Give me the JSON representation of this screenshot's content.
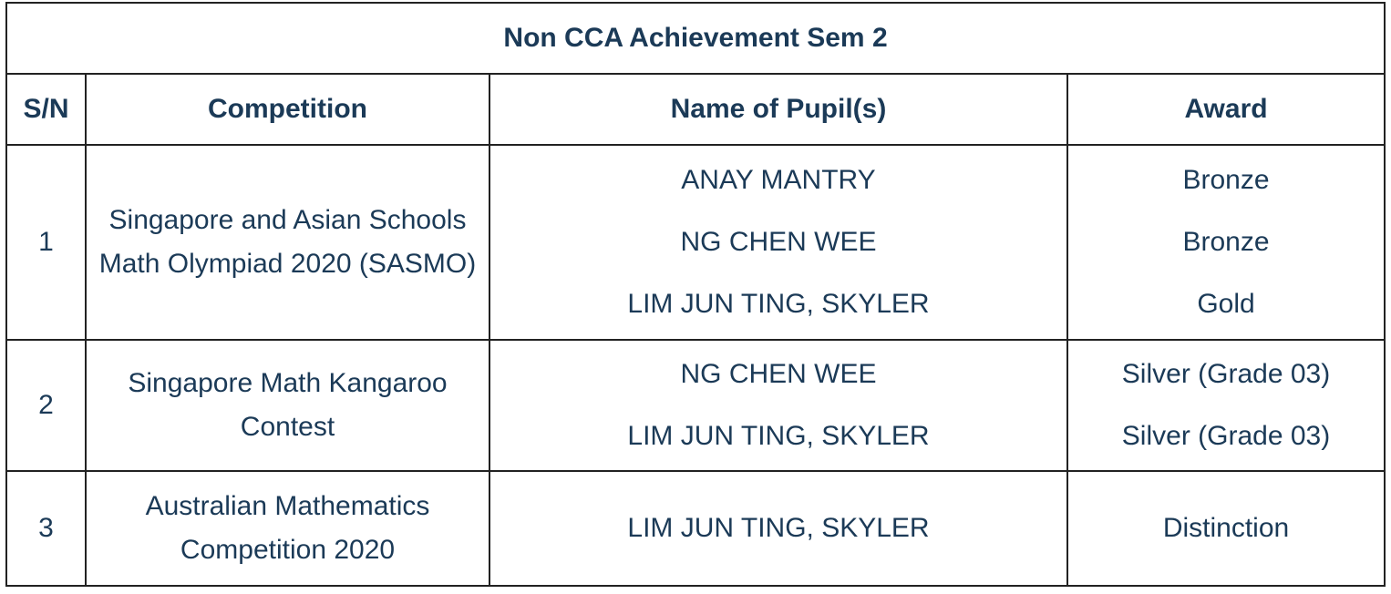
{
  "table": {
    "title": "Non CCA Achievement Sem 2",
    "headers": [
      "S/N",
      "Competition",
      "Name of Pupil(s)",
      "Award"
    ],
    "rows": [
      {
        "sn": "1",
        "competition": "Singapore and Asian Schools Math Olympiad 2020 (SASMO)",
        "entries": [
          {
            "pupil": "ANAY MANTRY",
            "award": "Bronze"
          },
          {
            "pupil": "NG CHEN WEE",
            "award": "Bronze"
          },
          {
            "pupil": "LIM JUN TING, SKYLER",
            "award": "Gold"
          }
        ]
      },
      {
        "sn": "2",
        "competition": "Singapore Math Kangaroo Contest",
        "entries": [
          {
            "pupil": "NG CHEN WEE",
            "award": "Silver (Grade 03)"
          },
          {
            "pupil": "LIM JUN TING, SKYLER",
            "award": "Silver (Grade 03)"
          }
        ]
      },
      {
        "sn": "3",
        "competition": "Australian Mathematics Competition 2020",
        "entries": [
          {
            "pupil": "LIM JUN TING, SKYLER",
            "award": "Distinction"
          }
        ]
      }
    ]
  }
}
